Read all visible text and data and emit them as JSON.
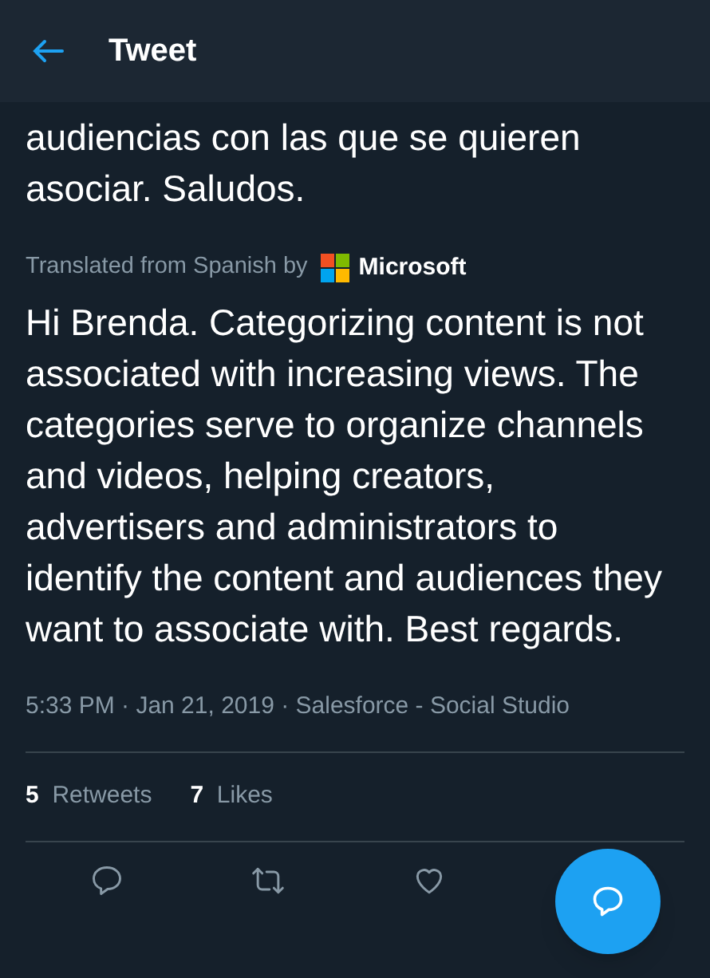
{
  "header": {
    "title": "Tweet"
  },
  "original_text": "audiencias con las que se quieren asociar. Saludos.",
  "translation_note": {
    "label": "Translated from Spanish by",
    "provider": "Microsoft"
  },
  "translated_text": "Hi Brenda. Categorizing content is not associated with increasing views. The categories serve to organize channels and videos, helping creators, advertisers and administrators to identify the content and audiences they want to associate with. Best regards.",
  "meta": "5:33 PM · Jan 21, 2019 · Salesforce - Social Studio",
  "stats": [
    {
      "count": "5",
      "label": "Retweets"
    },
    {
      "count": "7",
      "label": "Likes"
    }
  ],
  "actions": [
    {
      "kind": "reply"
    },
    {
      "kind": "retweet"
    },
    {
      "kind": "like"
    }
  ]
}
